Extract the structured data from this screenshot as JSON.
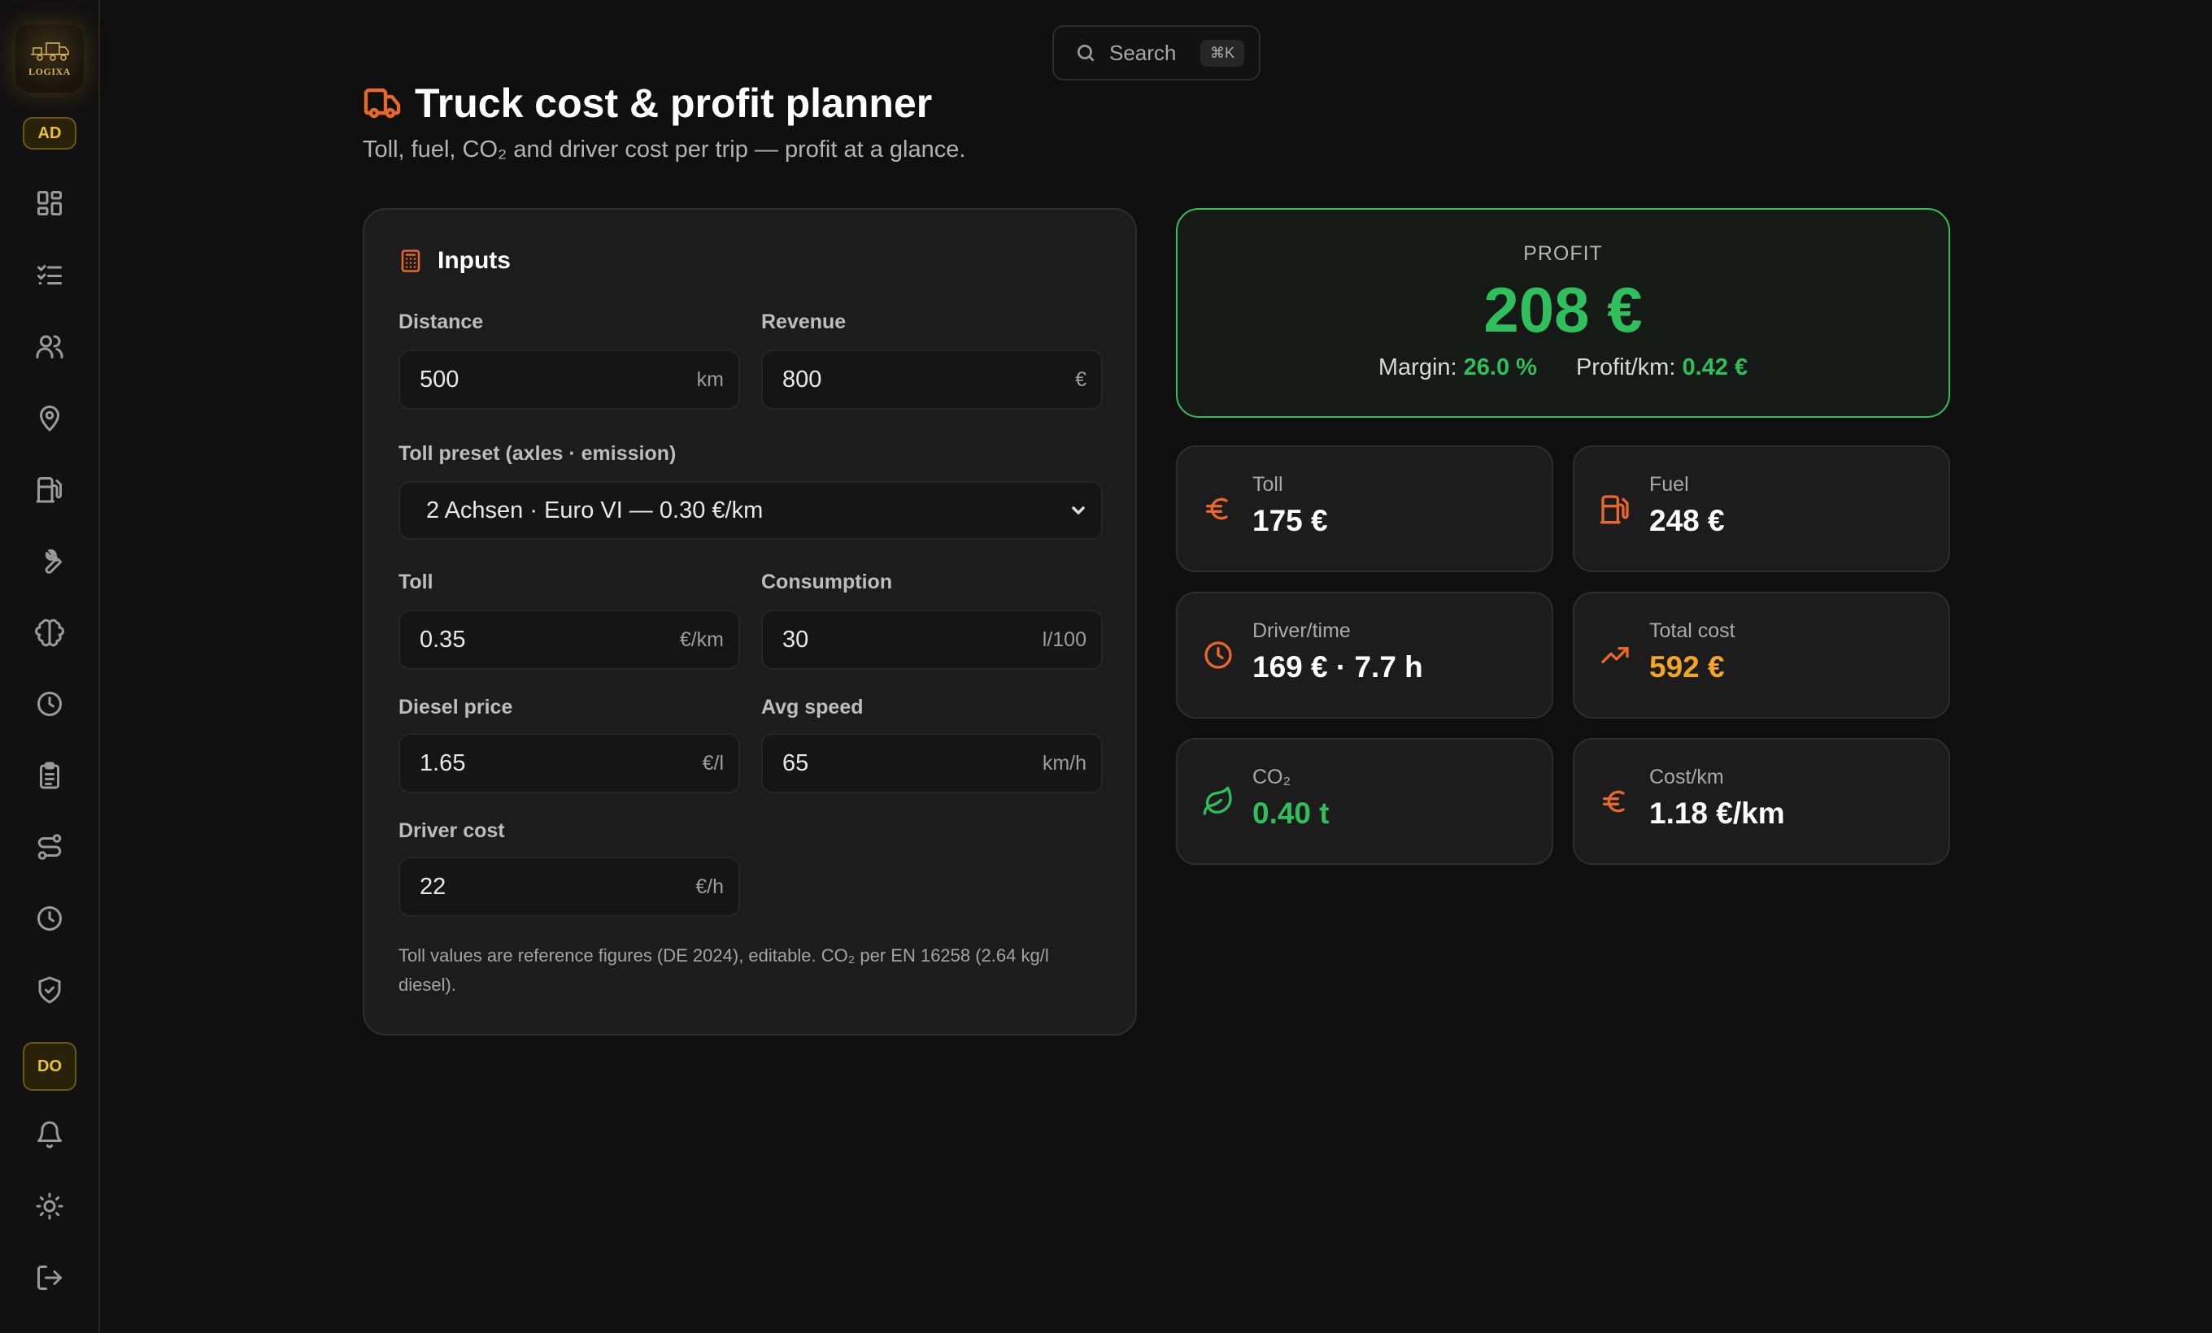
{
  "sidebar": {
    "logo_text": "LOGIXA",
    "top_badge": "AD",
    "bottom_badge": "DO",
    "icons": [
      "dashboard-icon",
      "checklist-icon",
      "users-icon",
      "map-pin-icon",
      "fuel-pump-icon",
      "wrench-icon",
      "brain-icon",
      "clock-icon",
      "clipboard-icon",
      "route-icon",
      "history-icon",
      "shield-check-icon",
      "bell-icon",
      "sun-icon",
      "logout-icon"
    ]
  },
  "search": {
    "label": "Search",
    "shortcut": "⌘K"
  },
  "header": {
    "title": "Truck cost & profit planner",
    "subtitle": "Toll, fuel, CO₂ and driver cost per trip — profit at a glance."
  },
  "inputs": {
    "title": "Inputs",
    "distance": {
      "label": "Distance",
      "value": "500",
      "unit": "km"
    },
    "revenue": {
      "label": "Revenue",
      "value": "800",
      "unit": "€"
    },
    "toll_preset": {
      "label": "Toll preset (axles · emission)",
      "value": "2 Achsen · Euro VI — 0.30 €/km"
    },
    "toll": {
      "label": "Toll",
      "value": "0.35",
      "unit": "€/km"
    },
    "consumption": {
      "label": "Consumption",
      "value": "30",
      "unit": "l/100"
    },
    "diesel_price": {
      "label": "Diesel price",
      "value": "1.65",
      "unit": "€/l"
    },
    "avg_speed": {
      "label": "Avg speed",
      "value": "65",
      "unit": "km/h"
    },
    "driver_cost": {
      "label": "Driver cost",
      "value": "22",
      "unit": "€/h"
    },
    "note": "Toll values are reference figures (DE 2024), editable. CO₂ per EN 16258 (2.64 kg/l diesel)."
  },
  "profit": {
    "label": "PROFIT",
    "value": "208 €",
    "margin_label": "Margin:",
    "margin_value": "26.0 %",
    "per_km_label": "Profit/km:",
    "per_km_value": "0.42 €"
  },
  "stats": {
    "toll": {
      "label": "Toll",
      "value": "175 €"
    },
    "fuel": {
      "label": "Fuel",
      "value": "248 €"
    },
    "driver_time": {
      "label": "Driver/time",
      "value": "169 € · 7.7 h"
    },
    "total_cost": {
      "label": "Total cost",
      "value": "592 €"
    },
    "co2": {
      "label": "CO₂",
      "value": "0.40 t"
    },
    "cost_per_km": {
      "label": "Cost/km",
      "value": "1.18 €/km"
    }
  },
  "colors": {
    "accent": "#e8672a",
    "profit_green": "#2fbf5c",
    "cost_orange": "#f2a624",
    "badge_gold": "#e9c23c"
  }
}
